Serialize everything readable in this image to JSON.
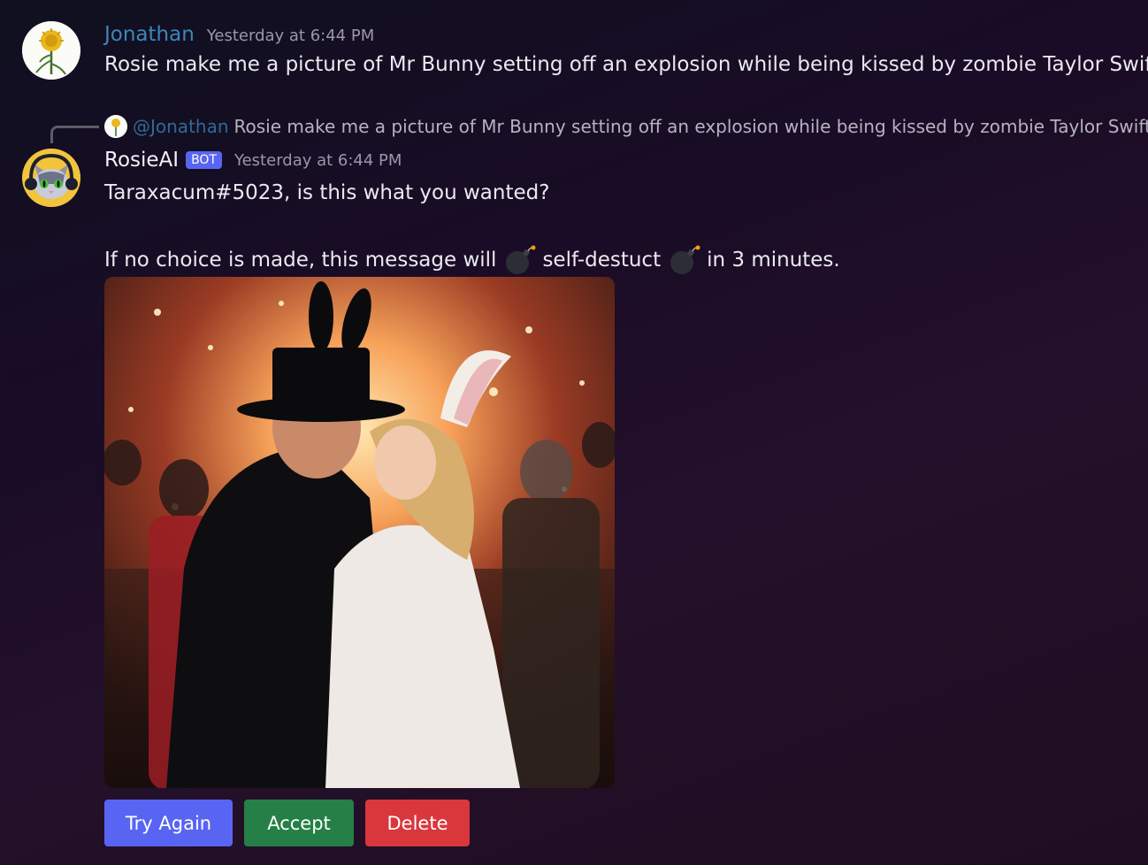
{
  "messages": [
    {
      "username": "Jonathan",
      "timestamp": "Yesterday at 6:44 PM",
      "content": "Rosie make me a picture of Mr Bunny setting off an explosion while being kissed by zombie Taylor Swift",
      "avatar_icon": "dandelion-avatar-icon"
    },
    {
      "reply": {
        "mention": "@Jonathan",
        "text": "Rosie make me a picture of Mr Bunny setting off an explosion while being kissed by zombie Taylor Swift"
      },
      "username": "RosieAI",
      "bot_tag": "BOT",
      "timestamp": "Yesterday at 6:44 PM",
      "line1": "Taraxacum#5023, is this what you wanted?",
      "line2": {
        "part1": "If no choice is made, this message will",
        "part2": "self-destuct",
        "part3": "in 3 minutes."
      },
      "emoji_icon": "bomb-icon",
      "attachment_icon": "generated-image",
      "buttons": {
        "try_again": "Try Again",
        "accept": "Accept",
        "delete": "Delete"
      },
      "button_colors": {
        "try_again": "#5865f2",
        "accept": "#248046",
        "delete": "#da373c"
      }
    }
  ],
  "colors": {
    "jonathan_name": "#3e86b8",
    "mention": "#2f6a96",
    "bot_tag": "#5865f2"
  }
}
